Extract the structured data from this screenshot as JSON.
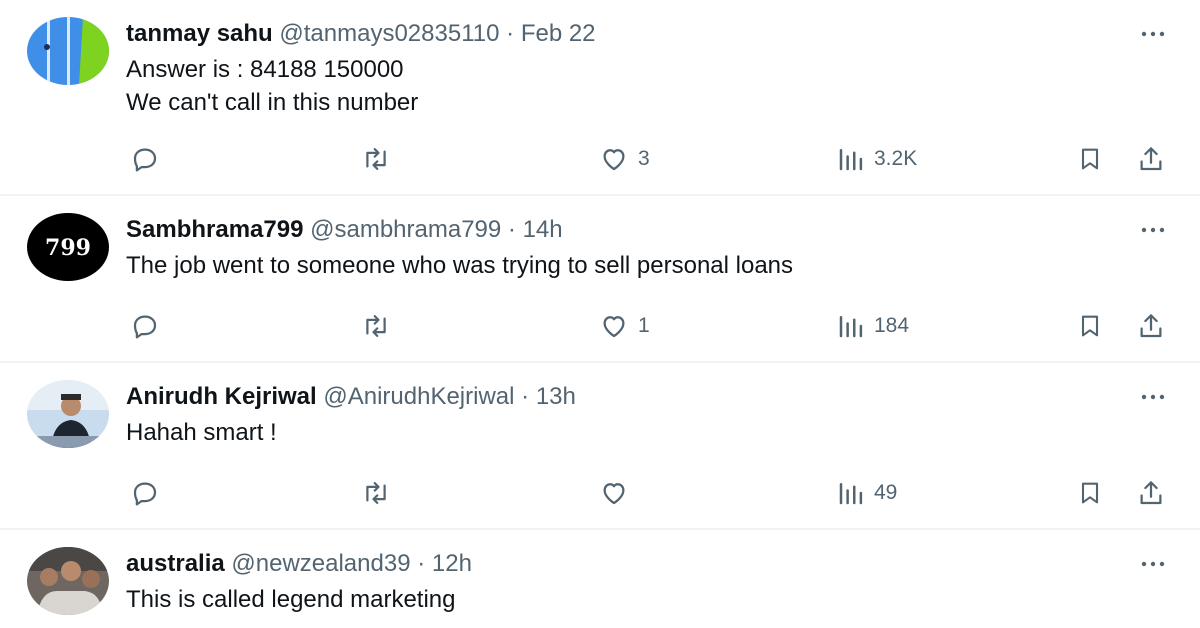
{
  "tweets": [
    {
      "name": "tanmay sahu",
      "handle": "@tanmays02835110",
      "separator": "·",
      "time": "Feb 22",
      "lines": [
        "Answer is : 84188 150000",
        "We can't call in this number"
      ],
      "likes": "3",
      "views": "3.2K",
      "avatar": "avatar-blue-green-icon"
    },
    {
      "name": "Sambhrama799",
      "handle": "@sambhrama799",
      "separator": "·",
      "time": "14h",
      "lines": [
        "The job went to someone who was trying to sell personal loans"
      ],
      "likes": "1",
      "views": "184",
      "avatar_text": "799"
    },
    {
      "name": "Anirudh Kejriwal",
      "handle": "@AnirudhKejriwal",
      "separator": "·",
      "time": "13h",
      "lines": [
        "Hahah smart !"
      ],
      "likes": "",
      "views": "49",
      "avatar": "avatar-person-photo-icon"
    },
    {
      "name": "australia",
      "handle": "@newzealand39",
      "separator": "·",
      "time": "12h",
      "lines": [
        "This is called legend marketing"
      ],
      "avatar": "avatar-group-photo-icon"
    }
  ],
  "colors": {
    "text": "#0f1419",
    "secondary": "#536471",
    "divider": "#eff3f4"
  }
}
